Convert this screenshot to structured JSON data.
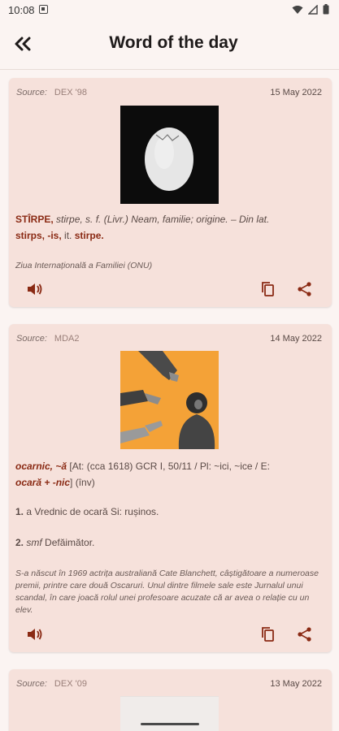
{
  "status": {
    "time": "10:08"
  },
  "appbar": {
    "title": "Word of the day",
    "back_icon": "double-chevron-left-icon"
  },
  "cards": [
    {
      "source_label": "Source:",
      "source": "DEX '98",
      "date": "15 May 2022",
      "def_headword": "STÎRPE,",
      "def_rest": " stirpe, s. f. (Livr.) Neam, familie; origine. – Din lat.",
      "def_line2_a": "stirps, -is,",
      "def_line2_b": " it. ",
      "def_line2_c": "stirpe.",
      "note": "Ziua Internațională a Familiei (ONU)"
    },
    {
      "source_label": "Source:",
      "source": "MDA2",
      "date": "14 May 2022",
      "def_headword": "ocarnic, ~ă",
      "def_rest": " [At: (cca 1618) GCR I, 50/11 / Pl: ~ici, ~ice / E:",
      "def_line2_a": "ocară + -nic",
      "def_line2_b": "] (înv)",
      "sense1_num": "1.",
      "sense1_text": " a Vrednic de ocară Si: rușinos.",
      "sense2_num": "2.",
      "sense2_pos": " smf",
      "sense2_text": " Defăimător.",
      "note": "S-a născut în 1969 actrița australiană Cate Blanchett, câștigătoare a numeroase premii, printre care două Oscaruri. Unul dintre filmele sale este Jurnalul unui scandal, în care joacă rolul unei profesoare acuzate că ar avea o relație cu un elev."
    },
    {
      "source_label": "Source:",
      "source": "DEX '09",
      "date": "13 May 2022"
    }
  ],
  "colors": {
    "accent": "#8a2a14",
    "card": "#f6e1db",
    "background": "#fbf4f2"
  }
}
